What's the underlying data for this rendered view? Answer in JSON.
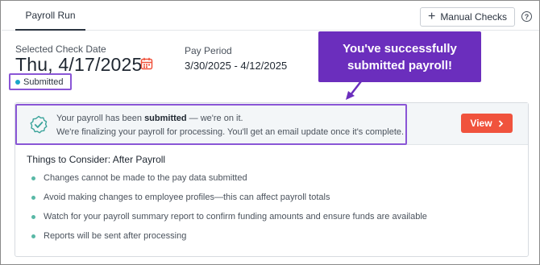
{
  "tabs": [
    {
      "label": "Payroll Run"
    }
  ],
  "toolbar": {
    "manual_checks_label": "Manual Checks",
    "help_icon": "?"
  },
  "check": {
    "label": "Selected Check Date",
    "date": "Thu, 4/17/2025",
    "period_label": "Pay Period",
    "period_value": "3/30/2025 - 4/12/2025",
    "status": "Submitted",
    "status_color": "#1aa6c9"
  },
  "callout": {
    "text": "You've successfully submitted payroll!",
    "color": "#6b2ebd"
  },
  "notice": {
    "line1_prefix": "Your payroll has been ",
    "line1_bold": "submitted",
    "line1_suffix": " — we're on it.",
    "line2": "We're finalizing your payroll for processing. You'll get an email update once it's complete."
  },
  "view_button": {
    "label": "View",
    "color": "#f0533d"
  },
  "consider": {
    "title": "Things to Consider: After Payroll",
    "items": [
      "Changes cannot be made to the pay data submitted",
      "Avoid making changes to employee profiles—this can affect payroll totals",
      "Watch for your payroll summary report to confirm funding amounts and ensure funds are available",
      "Reports will be sent after processing"
    ]
  },
  "accent_highlight": "#8a56d6"
}
